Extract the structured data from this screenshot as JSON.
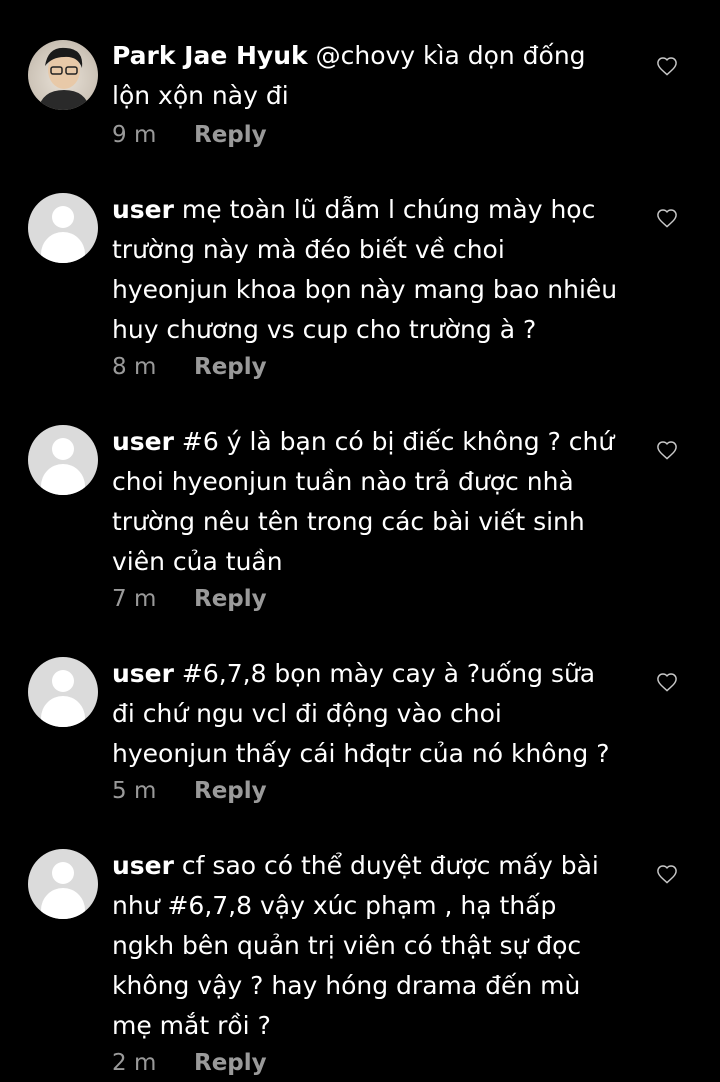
{
  "comments": [
    {
      "username": "Park Jae Hyuk",
      "text": "@chovy kìa dọn đống lộn xộn này đi",
      "time": "9 m",
      "reply": "Reply",
      "avatar": "user-photo",
      "liked": false
    },
    {
      "username": "user",
      "text": "mẹ toàn lũ dẫm l chúng mày học trường này mà đéo biết về choi hyeonjun khoa bọn này mang bao nhiêu huy chương vs cup cho trường à ?",
      "time": "8 m",
      "reply": "Reply",
      "avatar": "default-avatar",
      "liked": false
    },
    {
      "username": "user",
      "text": "#6 ý là bạn có bị điếc không ? chứ choi hyeonjun tuần nào trả được nhà trường nêu tên trong các bài viết sinh viên của tuần",
      "time": "7 m",
      "reply": "Reply",
      "avatar": "default-avatar",
      "liked": false
    },
    {
      "username": "user",
      "text": "#6,7,8 bọn mày cay à ?uống sữa đi chứ ngu vcl đi động vào choi hyeonjun thấy cái hđqtr của nó không ?",
      "time": "5 m",
      "reply": "Reply",
      "avatar": "default-avatar",
      "liked": false
    },
    {
      "username": "user",
      "text": "cf sao có thể duyệt được mấy bài như #6,7,8 vậy xúc phạm , hạ thấp ngkh bên quản trị viên có thật sự đọc không vậy ? hay hóng drama đến mù mẹ mắt rồi ?",
      "time": "2 m",
      "reply": "Reply",
      "avatar": "default-avatar",
      "liked": false
    }
  ],
  "colors": {
    "background": "#000000",
    "text": "#ffffff",
    "meta": "#9a9a9a",
    "avatar_placeholder": "#dbdbdb"
  },
  "icons": {
    "like": "heart-outline-icon"
  }
}
